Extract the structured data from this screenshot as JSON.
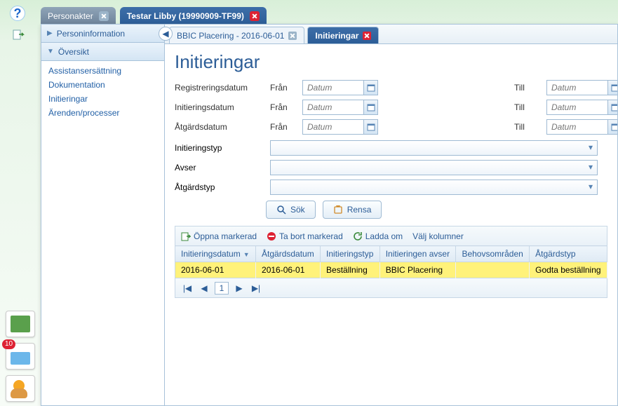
{
  "leftbar": {
    "folder_badge": "10"
  },
  "window_tabs": [
    {
      "label": "Personakter",
      "active": false
    },
    {
      "label": "Testar Libby (19990909-TF99)",
      "active": true
    }
  ],
  "sidebar": {
    "section1": "Personinformation",
    "section2": "Översikt",
    "items": [
      "Assistansersättning",
      "Dokumentation",
      "Initieringar",
      "Ärenden/processer"
    ]
  },
  "subtabs": [
    {
      "label": "BBIC Placering - 2016-06-01",
      "active": false
    },
    {
      "label": "Initieringar",
      "active": true
    }
  ],
  "page_title": "Initieringar",
  "filters": {
    "rows": [
      {
        "label": "Registreringsdatum",
        "from_label": "Från",
        "to_label": "Till",
        "placeholder": "Datum"
      },
      {
        "label": "Initieringsdatum",
        "from_label": "Från",
        "to_label": "Till",
        "placeholder": "Datum"
      },
      {
        "label": "Åtgärdsdatum",
        "from_label": "Från",
        "to_label": "Till",
        "placeholder": "Datum"
      }
    ],
    "combos": [
      {
        "label": "Initieringstyp"
      },
      {
        "label": "Avser"
      },
      {
        "label": "Åtgärdstyp"
      }
    ],
    "search_btn": "Sök",
    "clear_btn": "Rensa"
  },
  "toolbar": {
    "open": "Öppna markerad",
    "delete": "Ta bort markerad",
    "reload": "Ladda om",
    "columns": "Välj kolumner"
  },
  "grid": {
    "headers": [
      "Initieringsdatum",
      "Åtgärdsdatum",
      "Initieringstyp",
      "Initieringen avser",
      "Behovsområden",
      "Åtgärdstyp"
    ],
    "rows": [
      [
        "2016-06-01",
        "2016-06-01",
        "Beställning",
        "BBIC Placering",
        "",
        "Godta beställning"
      ]
    ]
  },
  "pager": {
    "page": "1"
  }
}
